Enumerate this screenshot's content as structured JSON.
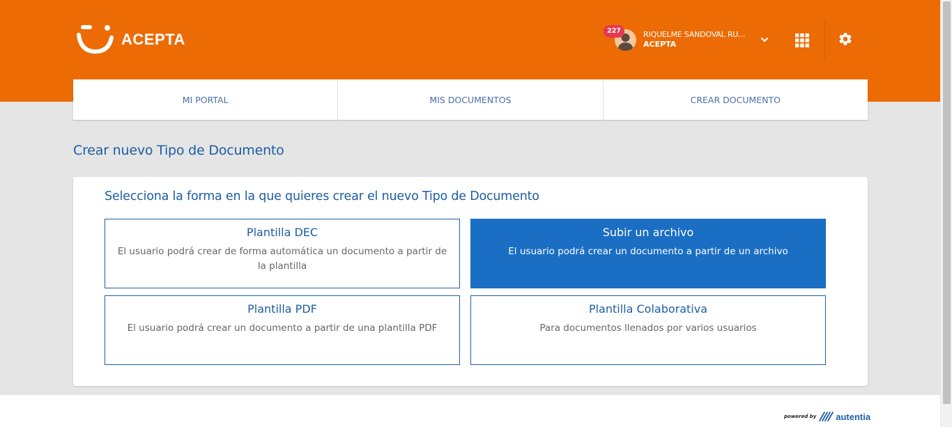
{
  "brand": {
    "name": "ACEPTA"
  },
  "user": {
    "notifications": "227",
    "name": "RIQUELME SANDOVAL RU...",
    "organization": "ACEPTA"
  },
  "header": {
    "apps_icon": "grid-icon",
    "settings_icon": "gear-icon"
  },
  "nav": {
    "tabs": [
      {
        "label": "MI PORTAL"
      },
      {
        "label": "MIS DOCUMENTOS"
      },
      {
        "label": "CREAR DOCUMENTO"
      }
    ]
  },
  "page": {
    "title": "Crear nuevo Tipo de Documento"
  },
  "panel": {
    "heading": "Selecciona la forma en la que quieres crear el nuevo Tipo de Documento",
    "options": [
      {
        "title": "Plantilla DEC",
        "description": "El usuario podrá crear de forma automática un documento a partir de la plantilla"
      },
      {
        "title": "Subir un archivo",
        "description": "El usuario podrá crear un documento a partir de un archivo",
        "selected": true
      },
      {
        "title": "Plantilla PDF",
        "description": "El usuario podrá crear un documento a partir de una plantilla PDF"
      },
      {
        "title": "Plantilla Colaborativa",
        "description": "Para documentos llenados por varios usuarios"
      }
    ]
  },
  "footer": {
    "powered_by": "powered by",
    "company": "autentia"
  },
  "colors": {
    "brand_orange": "#ec6b05",
    "primary_blue": "#1b5da3",
    "selected_blue": "#1a6ec3",
    "badge_red": "#e53950",
    "background": "#e5e5e5"
  }
}
